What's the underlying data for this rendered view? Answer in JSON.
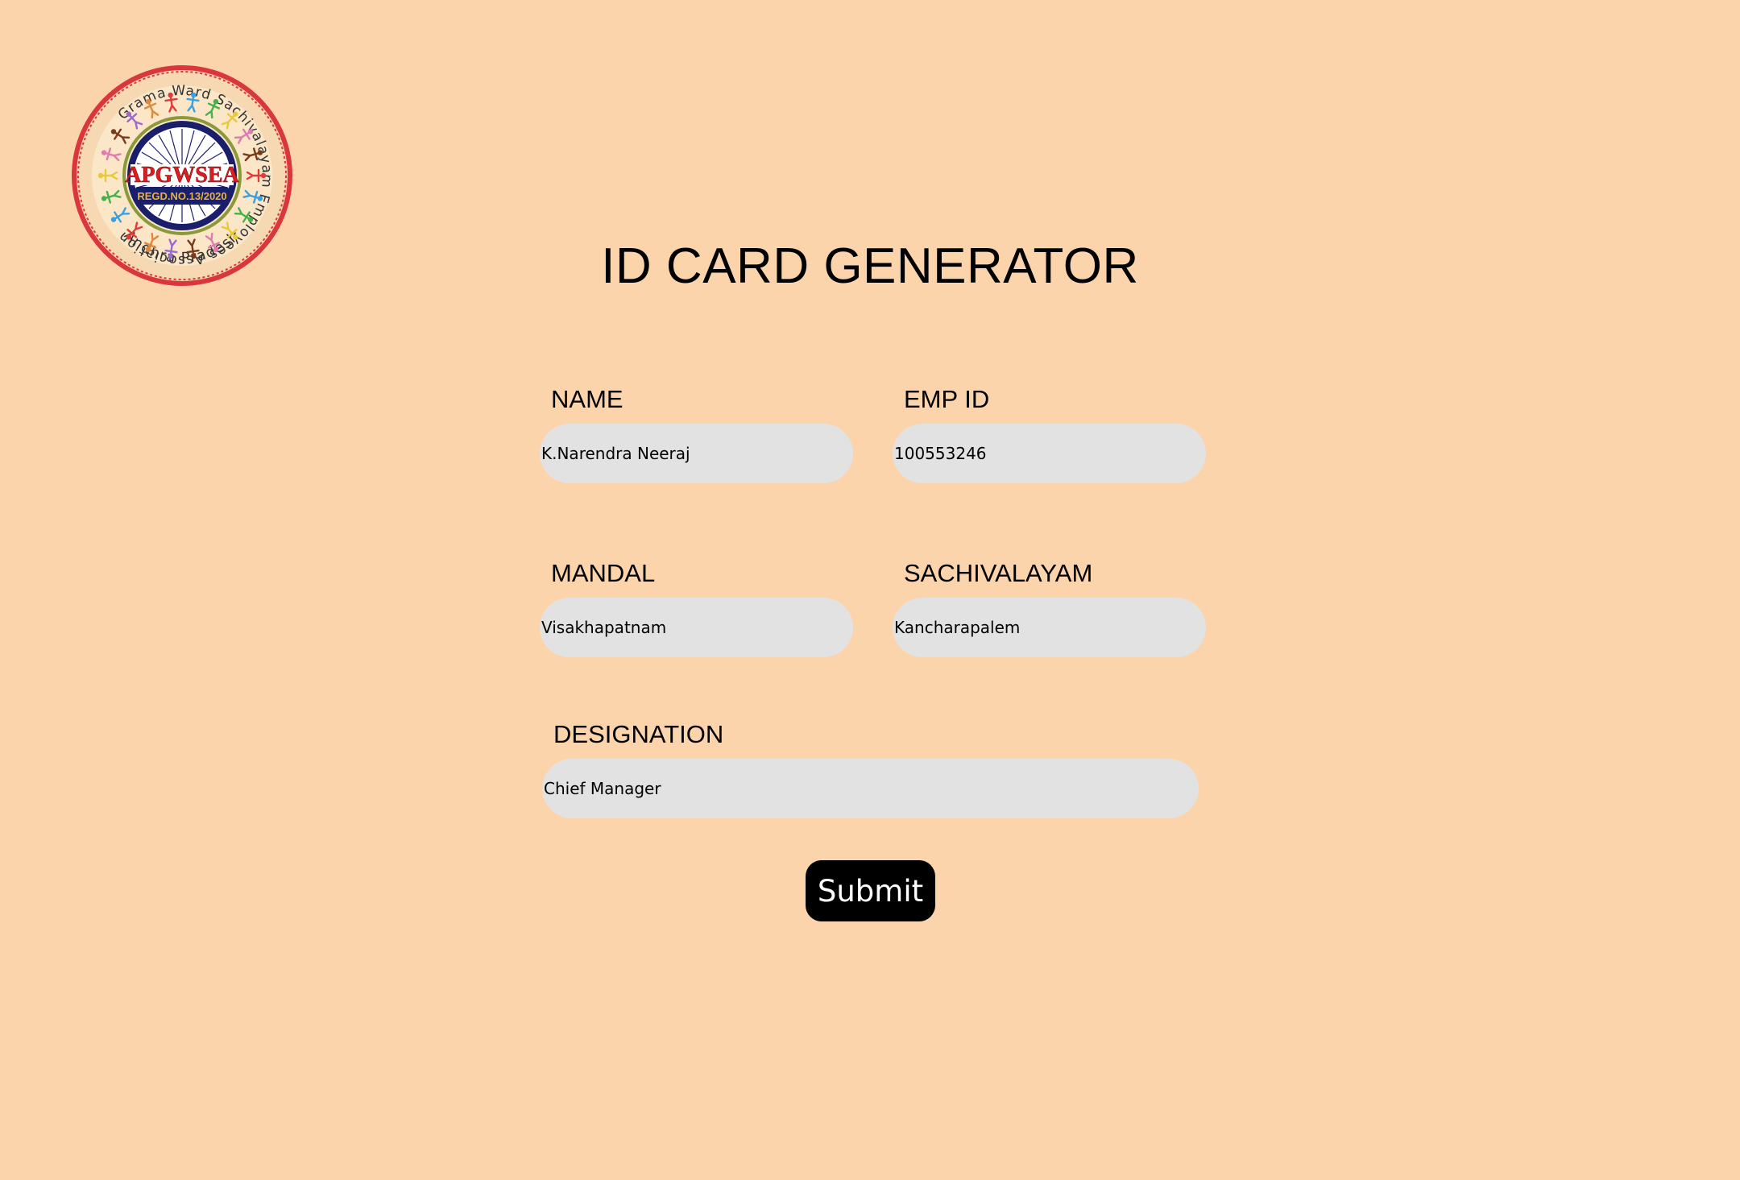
{
  "logo": {
    "ring_text_top": "Grama Ward Sachivalayam Employees Association",
    "ring_text_bottom": "Andhra Pradesh",
    "acronym": "APGWSEA",
    "registration": "REGD.NO.13/2020"
  },
  "page": {
    "title": "ID CARD GENERATOR"
  },
  "form": {
    "name": {
      "label": "NAME",
      "value": "K.Narendra Neeraj"
    },
    "emp_id": {
      "label": "EMP ID",
      "value": "100553246"
    },
    "mandal": {
      "label": "MANDAL",
      "value": "Visakhapatnam"
    },
    "sachivalayam": {
      "label": "SACHIVALAYAM",
      "value": "Kancharapalem"
    },
    "designation": {
      "label": "DESIGNATION",
      "value": "Chief Manager"
    },
    "submit_label": "Submit"
  },
  "colors": {
    "background": "#fcd4ab",
    "input_bg": "#e2e2e2",
    "button_bg": "#000000",
    "logo_ring": "#d9363e",
    "logo_inner": "#1a1f6b"
  }
}
